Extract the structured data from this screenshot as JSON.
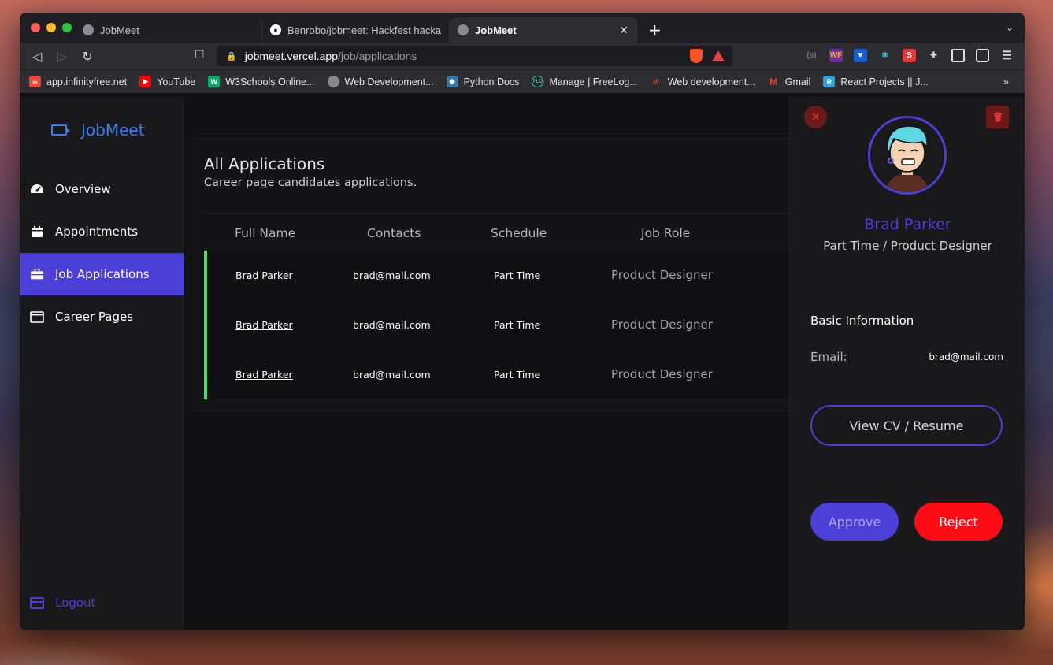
{
  "browser": {
    "tabs": [
      {
        "title": "JobMeet"
      },
      {
        "title": "Benrobo/jobmeet: Hackfest hackath"
      },
      {
        "title": "JobMeet"
      }
    ],
    "url_host": "jobmeet.vercel.app",
    "url_path": "/job/applications",
    "bookmarks": [
      {
        "label": "app.infinityfree.net",
        "color": "#e8463a"
      },
      {
        "label": "YouTube",
        "color": "#ff0000"
      },
      {
        "label": "W3Schools Online...",
        "color": "#04aa6d"
      },
      {
        "label": "Web Development...",
        "color": "#888888"
      },
      {
        "label": "Python Docs",
        "color": "#f7c948"
      },
      {
        "label": "Manage | FreeLog...",
        "color": "#3bc1b4"
      },
      {
        "label": "Web development...",
        "color": "#e0502b"
      },
      {
        "label": "Gmail",
        "color": "#ea4335"
      },
      {
        "label": "React Projects || J...",
        "color": "#2aa6d8"
      }
    ]
  },
  "app": {
    "brand": "JobMeet",
    "nav": [
      {
        "label": "Overview",
        "icon": "dashboard-icon"
      },
      {
        "label": "Appointments",
        "icon": "calendar-icon"
      },
      {
        "label": "Job Applications",
        "icon": "briefcase-icon"
      },
      {
        "label": "Career Pages",
        "icon": "browser-window-icon"
      }
    ],
    "logout": "Logout",
    "colors": {
      "accent": "#4b3fd8",
      "brand": "#3a7df0",
      "status_bar": "#4bd96a",
      "danger": "#ff0b16"
    }
  },
  "applications": {
    "title": "All Applications",
    "subtitle": "Career page candidates applications.",
    "columns": [
      "Full Name",
      "Contacts",
      "Schedule",
      "Job Role"
    ],
    "rows": [
      {
        "name": "Brad Parker",
        "email": "brad@mail.com",
        "schedule": "Part Time",
        "role": "Product Designer"
      },
      {
        "name": "Brad Parker",
        "email": "brad@mail.com",
        "schedule": "Part Time",
        "role": "Product Designer"
      },
      {
        "name": "Brad Parker",
        "email": "brad@mail.com",
        "schedule": "Part Time",
        "role": "Product Designer"
      }
    ]
  },
  "detail": {
    "name": "Brad Parker",
    "role": "Part Time / Product Designer",
    "section_title": "Basic Information",
    "email_label": "Email:",
    "email_value": "brad@mail.com",
    "cv_button": "View CV / Resume",
    "approve_button": "Approve",
    "reject_button": "Reject"
  }
}
